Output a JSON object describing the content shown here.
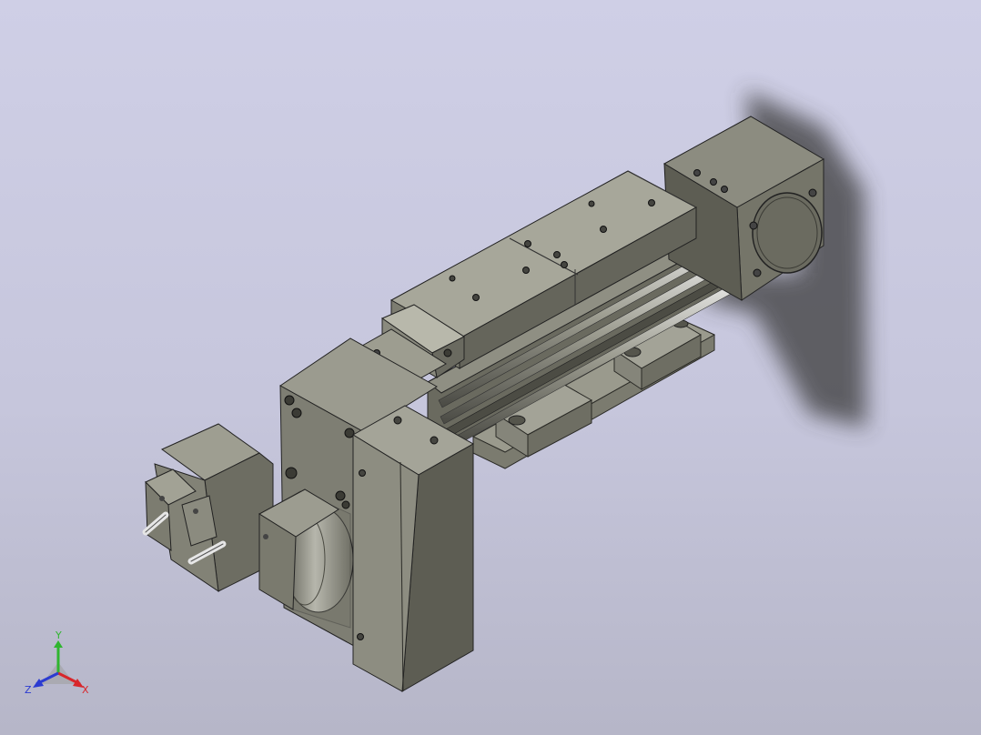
{
  "viewport": {
    "background_top": "#cfcfe6",
    "background_bottom": "#b6b6c8",
    "model": "linear-actuator-assembly"
  },
  "triad": {
    "x_label": "X",
    "y_label": "Y",
    "z_label": "Z",
    "x_color": "#d8262b",
    "y_color": "#2fb52f",
    "z_color": "#2b3bd1"
  }
}
